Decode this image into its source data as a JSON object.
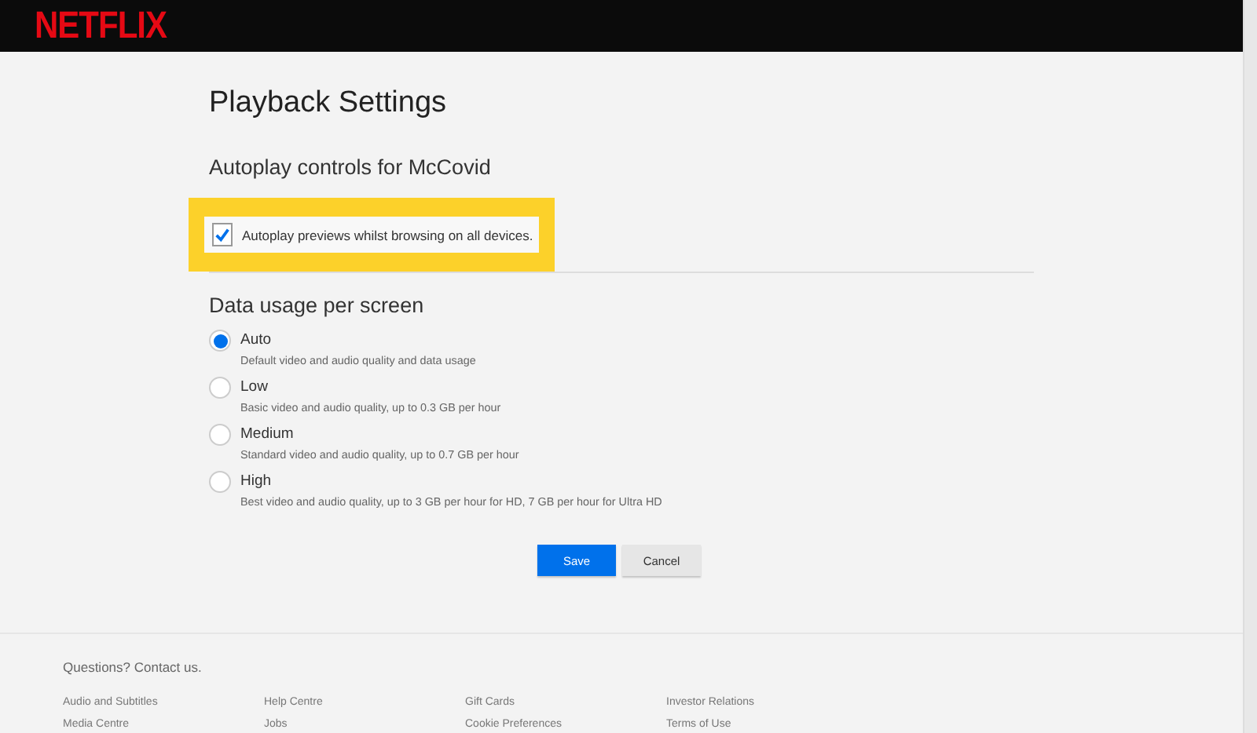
{
  "header": {
    "logo": "NETFLIX"
  },
  "title": "Playback Settings",
  "autoplay": {
    "heading": "Autoplay controls for McCovid",
    "options": [
      {
        "label": "Autoplay previews whilst browsing on all devices.",
        "checked": true,
        "highlighted": true
      }
    ]
  },
  "data_usage": {
    "heading": "Data usage per screen",
    "options": [
      {
        "label": "Auto",
        "description": "Default video and audio quality and data usage",
        "selected": true
      },
      {
        "label": "Low",
        "description": "Basic video and audio quality, up to 0.3 GB per hour",
        "selected": false
      },
      {
        "label": "Medium",
        "description": "Standard video and audio quality, up to 0.7 GB per hour",
        "selected": false
      },
      {
        "label": "High",
        "description": "Best video and audio quality, up to 3 GB per hour for HD, 7 GB per hour for Ultra HD",
        "selected": false
      }
    ]
  },
  "buttons": [
    {
      "label": "Save",
      "kind": "primary"
    },
    {
      "label": "Cancel",
      "kind": "secondary"
    }
  ],
  "footer": {
    "contact": "Questions? Contact us.",
    "links": [
      "Audio and Subtitles",
      "Help Centre",
      "Gift Cards",
      "Investor Relations",
      "Media Centre",
      "Jobs",
      "Cookie Preferences",
      "Terms of Use"
    ]
  }
}
